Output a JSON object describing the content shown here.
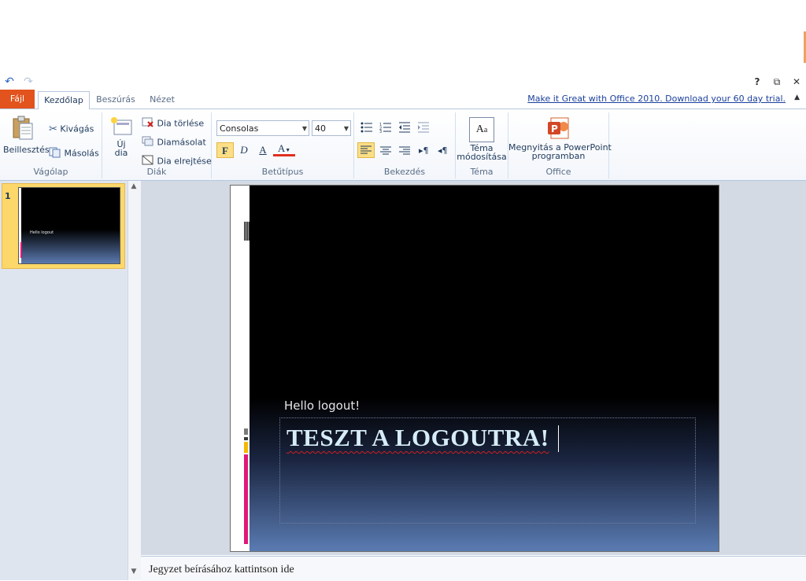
{
  "quick_access": {
    "undo_icon": "undo-icon",
    "redo_icon": "redo-icon"
  },
  "window_controls": {
    "help": "?",
    "restore": "⧉",
    "close": "✕"
  },
  "tabs": [
    {
      "label": "Fájl"
    },
    {
      "label": "Kezdőlap"
    },
    {
      "label": "Beszúrás"
    },
    {
      "label": "Nézet"
    }
  ],
  "promo_link": "Make it Great with Office 2010. Download your 60 day trial.",
  "ribbon": {
    "clipboard": {
      "group_label": "Vágólap",
      "paste": "Beillesztés",
      "cut": "Kivágás",
      "copy": "Másolás"
    },
    "slides": {
      "group_label": "Diák",
      "new_slide_line1": "Új",
      "new_slide_line2": "dia",
      "delete": "Dia törlése",
      "duplicate": "Diamásolat",
      "hide": "Dia elrejtése"
    },
    "font": {
      "group_label": "Betűtípus",
      "font_name": "Consolas",
      "font_size": "40",
      "bold": "F",
      "italic": "D",
      "underline": "A",
      "color": "A"
    },
    "paragraph": {
      "group_label": "Bekezdés"
    },
    "theme": {
      "group_label": "Téma",
      "button_line1": "Téma",
      "button_line2": "módosítása"
    },
    "office": {
      "group_label": "Office",
      "button_line1": "Megnyitás a PowerPoint",
      "button_line2": "programban"
    }
  },
  "thumbnails": [
    {
      "number": "1",
      "text": "Hello logout"
    }
  ],
  "slide": {
    "subtitle": "Hello logout!",
    "title": "TESZT A LOGOUTRA!"
  },
  "notes_placeholder": "Jegyzet beírásához kattintson ide",
  "colors": {
    "file_tab": "#e2531d",
    "accent_pink": "#e0187a",
    "accent_yellow": "#f5b800",
    "accent_gray": "#7a7a7a",
    "title_text": "#d6ecf7"
  }
}
